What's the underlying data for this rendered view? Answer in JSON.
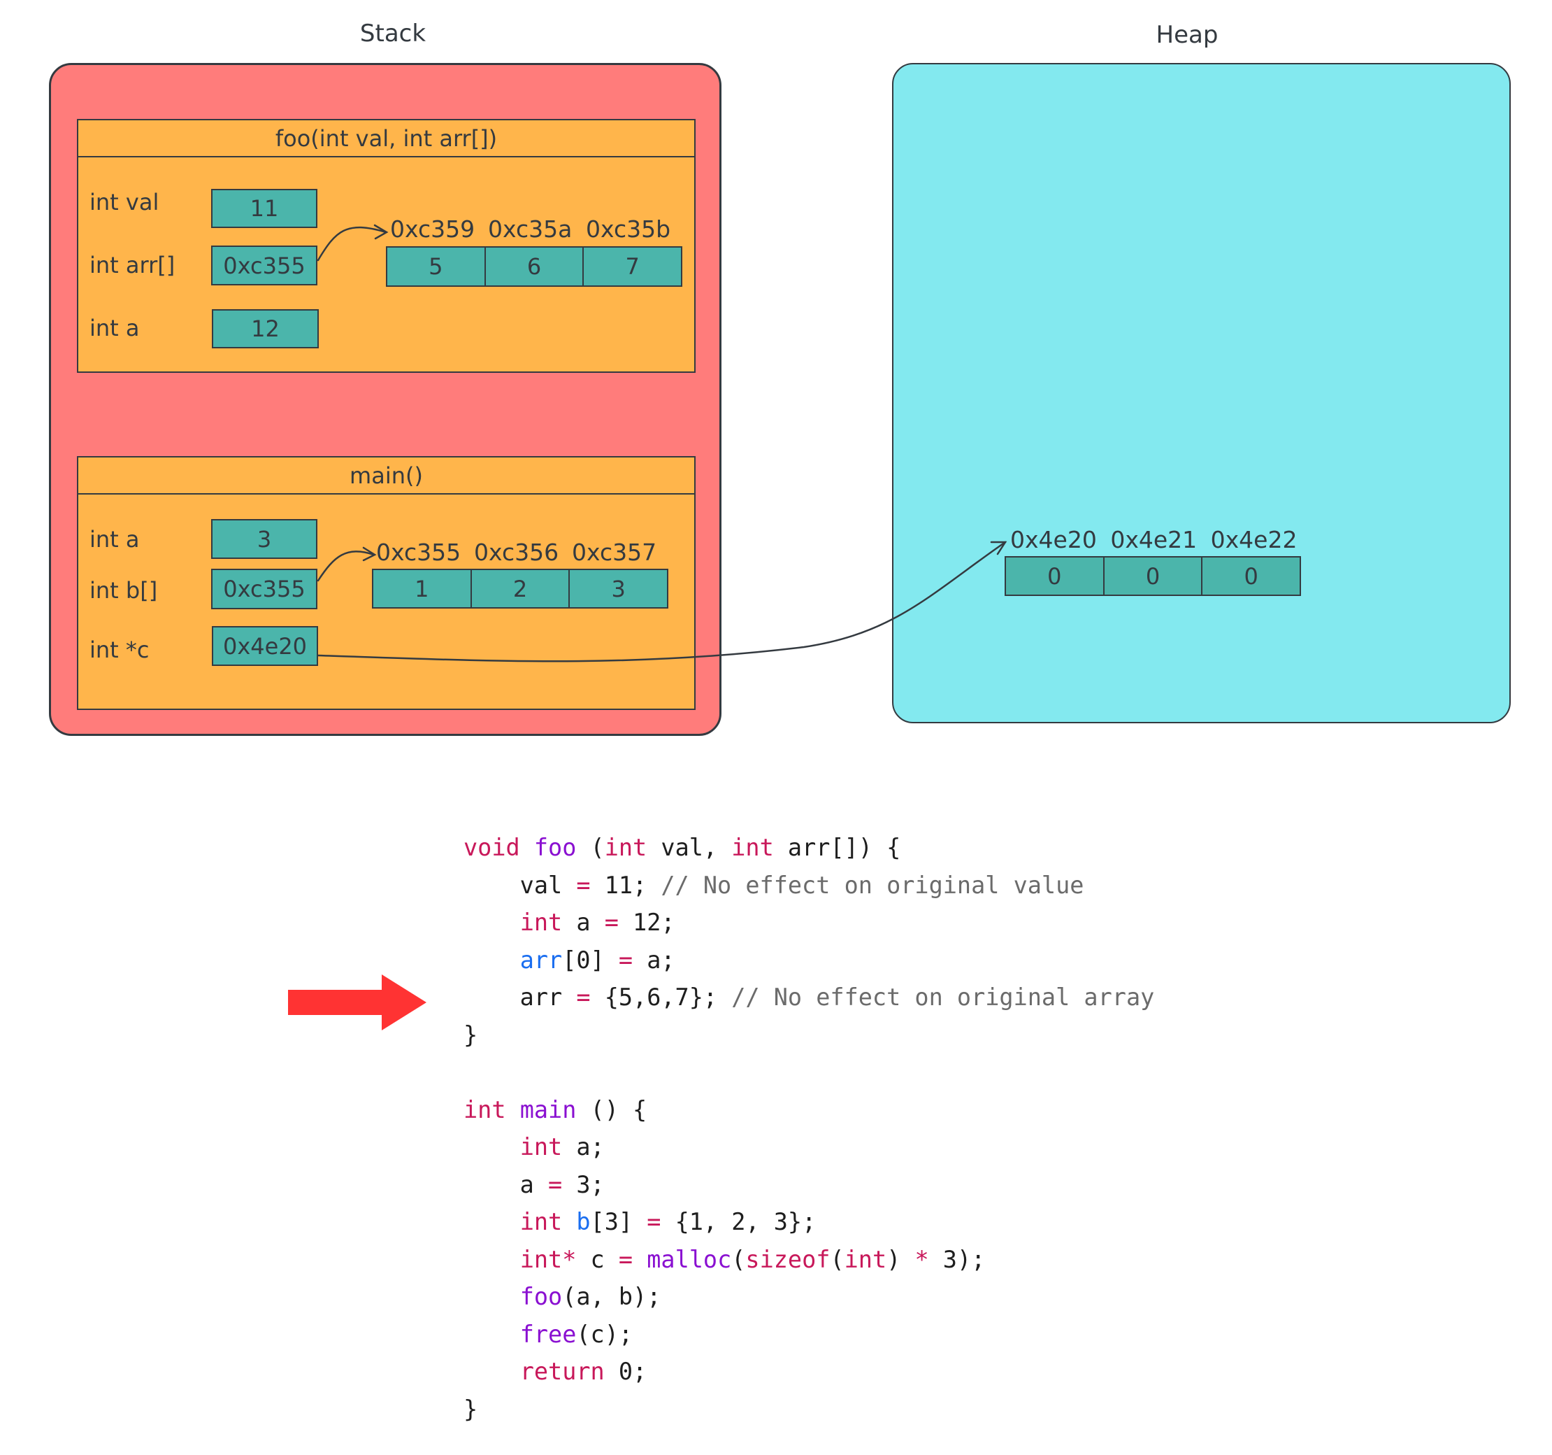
{
  "stack": {
    "title": "Stack",
    "frames": [
      {
        "header": "foo(int val, int arr[])",
        "vars": [
          {
            "label": "int val",
            "value": "11"
          },
          {
            "label": "int arr[]",
            "value": "0xc355"
          },
          {
            "label": "int a",
            "value": "12"
          }
        ],
        "array": {
          "addresses": [
            "0xc359",
            "0xc35a",
            "0xc35b"
          ],
          "values": [
            "5",
            "6",
            "7"
          ]
        }
      },
      {
        "header": "main()",
        "vars": [
          {
            "label": "int a",
            "value": "3"
          },
          {
            "label": "int b[]",
            "value": "0xc355"
          },
          {
            "label": "int *c",
            "value": "0x4e20"
          }
        ],
        "array": {
          "addresses": [
            "0xc355",
            "0xc356",
            "0xc357"
          ],
          "values": [
            "1",
            "2",
            "3"
          ]
        }
      }
    ]
  },
  "heap": {
    "title": "Heap",
    "array": {
      "addresses": [
        "0x4e20",
        "0x4e21",
        "0x4e22"
      ],
      "values": [
        "0",
        "0",
        "0"
      ]
    }
  },
  "colors": {
    "stack_bg": "#ff7c7b",
    "heap_bg": "#83e9ef",
    "frame_bg": "#ffb54b",
    "cell_bg": "#4bb5ab",
    "stroke": "#343a40",
    "current_line_arrow": "#ff3333"
  },
  "code": {
    "current_line_index": 4,
    "lines": [
      [
        {
          "t": "void",
          "c": "kw"
        },
        {
          "t": " "
        },
        {
          "t": "foo",
          "c": "fn"
        },
        {
          "t": " ("
        },
        {
          "t": "int",
          "c": "kw"
        },
        {
          "t": " val, "
        },
        {
          "t": "int",
          "c": "kw"
        },
        {
          "t": " arr[]) {"
        }
      ],
      [
        {
          "t": "    val "
        },
        {
          "t": "=",
          "c": "op"
        },
        {
          "t": " 11; "
        },
        {
          "t": "// No effect on original value",
          "c": "cm"
        }
      ],
      [
        {
          "t": "    "
        },
        {
          "t": "int",
          "c": "kw"
        },
        {
          "t": " a "
        },
        {
          "t": "=",
          "c": "op"
        },
        {
          "t": " 12;"
        }
      ],
      [
        {
          "t": "    "
        },
        {
          "t": "arr",
          "c": "var"
        },
        {
          "t": "[0] "
        },
        {
          "t": "=",
          "c": "op"
        },
        {
          "t": " a;"
        }
      ],
      [
        {
          "t": "    arr "
        },
        {
          "t": "=",
          "c": "op"
        },
        {
          "t": " {5,6,7}; "
        },
        {
          "t": "// No effect on original array",
          "c": "cm"
        }
      ],
      [
        {
          "t": "}"
        }
      ],
      [
        {
          "t": ""
        }
      ],
      [
        {
          "t": "int",
          "c": "kw"
        },
        {
          "t": " "
        },
        {
          "t": "main",
          "c": "fn"
        },
        {
          "t": " () {"
        }
      ],
      [
        {
          "t": "    "
        },
        {
          "t": "int",
          "c": "kw"
        },
        {
          "t": " a;"
        }
      ],
      [
        {
          "t": "    a "
        },
        {
          "t": "=",
          "c": "op"
        },
        {
          "t": " 3;"
        }
      ],
      [
        {
          "t": "    "
        },
        {
          "t": "int",
          "c": "kw"
        },
        {
          "t": " "
        },
        {
          "t": "b",
          "c": "var"
        },
        {
          "t": "[3] "
        },
        {
          "t": "=",
          "c": "op"
        },
        {
          "t": " {1, 2, 3};"
        }
      ],
      [
        {
          "t": "    "
        },
        {
          "t": "int*",
          "c": "kw"
        },
        {
          "t": " c "
        },
        {
          "t": "=",
          "c": "op"
        },
        {
          "t": " "
        },
        {
          "t": "malloc",
          "c": "fn"
        },
        {
          "t": "("
        },
        {
          "t": "sizeof",
          "c": "kw"
        },
        {
          "t": "("
        },
        {
          "t": "int",
          "c": "kw"
        },
        {
          "t": ") "
        },
        {
          "t": "*",
          "c": "op"
        },
        {
          "t": " 3);"
        }
      ],
      [
        {
          "t": "    "
        },
        {
          "t": "foo",
          "c": "fn"
        },
        {
          "t": "(a, b);"
        }
      ],
      [
        {
          "t": "    "
        },
        {
          "t": "free",
          "c": "fn"
        },
        {
          "t": "(c);"
        }
      ],
      [
        {
          "t": "    "
        },
        {
          "t": "return",
          "c": "kw"
        },
        {
          "t": " 0;"
        }
      ],
      [
        {
          "t": "}"
        }
      ]
    ]
  }
}
